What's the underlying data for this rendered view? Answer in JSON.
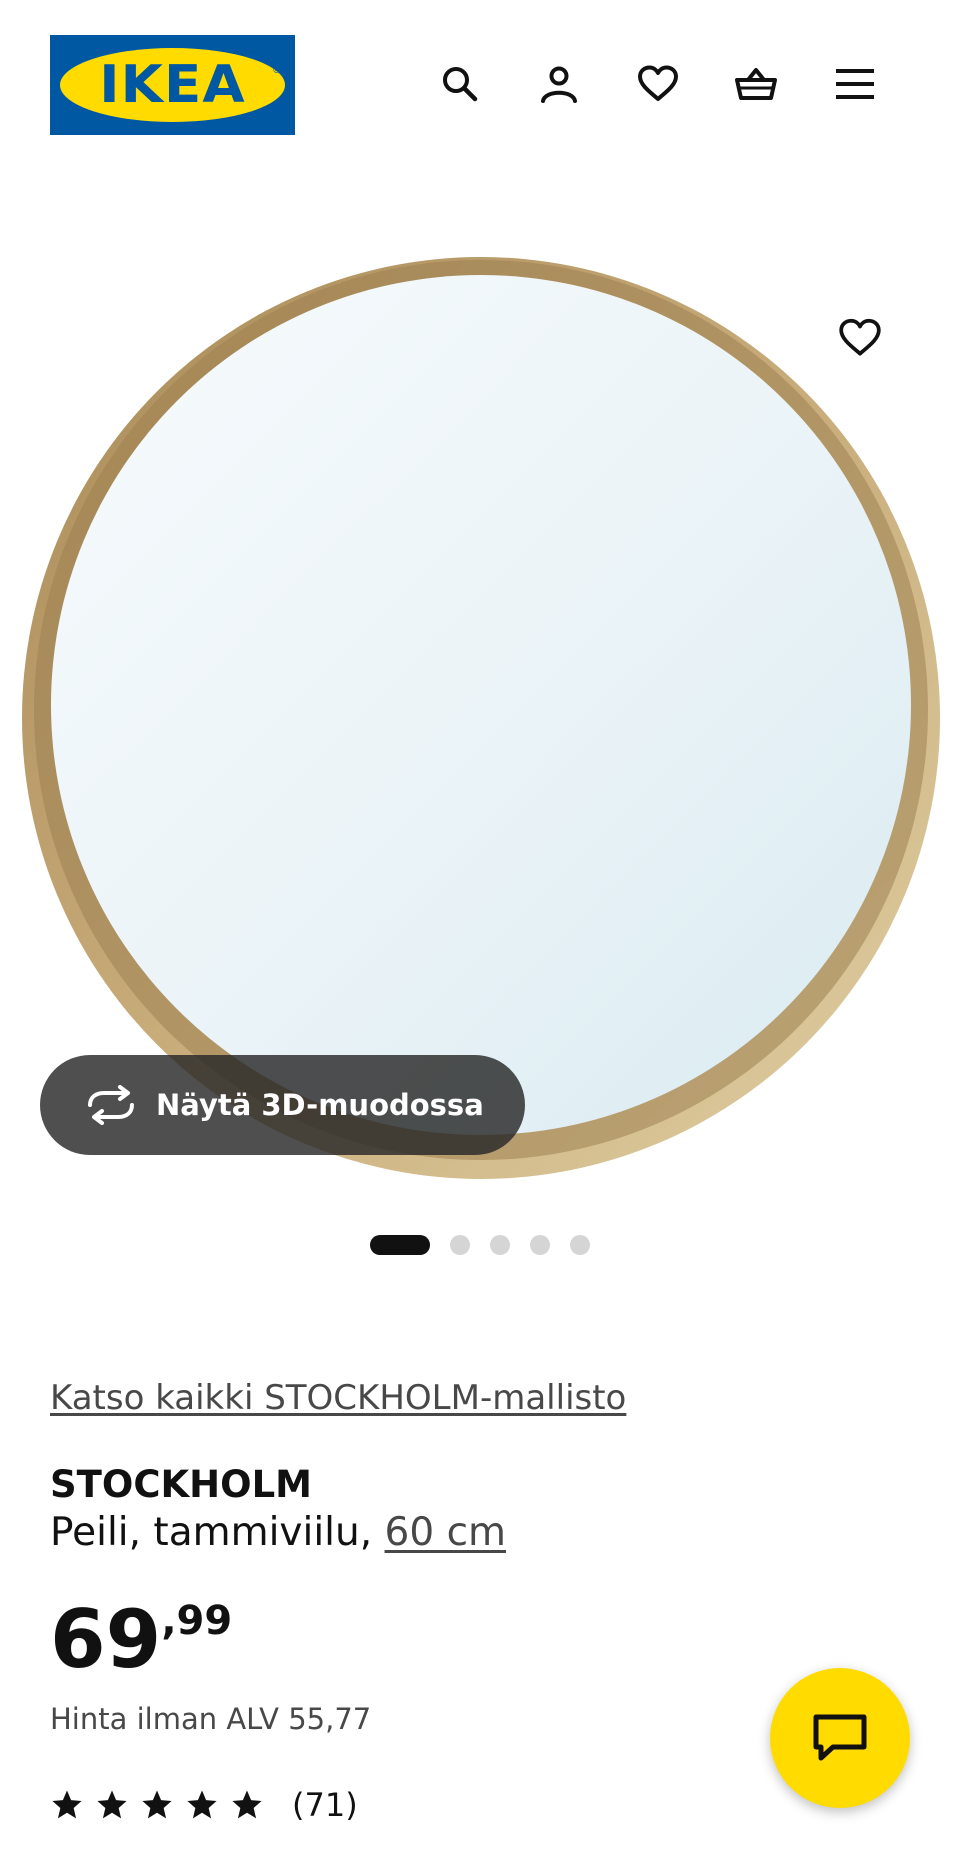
{
  "header": {
    "logo_text": "IKEA",
    "icons": [
      "search-icon",
      "account-icon",
      "heart-icon",
      "basket-icon",
      "menu-icon"
    ]
  },
  "gallery": {
    "view_3d_label": "Näytä 3D-muodossa",
    "image_count": 5,
    "active_index": 0
  },
  "product": {
    "collection_link": "Katso kaikki STOCKHOLM-mallisto",
    "name": "STOCKHOLM",
    "description": "Peili, tammiviilu,",
    "size": "60 cm",
    "price_integer": "69",
    "price_decimal": ",99",
    "vat_note": "Hinta ilman ALV 55,77",
    "rating_stars": 5,
    "review_count": "(71)"
  },
  "colors": {
    "brand_blue": "#0058a3",
    "brand_yellow": "#ffdb00",
    "text_dark": "#111111",
    "text_muted": "#484848"
  }
}
